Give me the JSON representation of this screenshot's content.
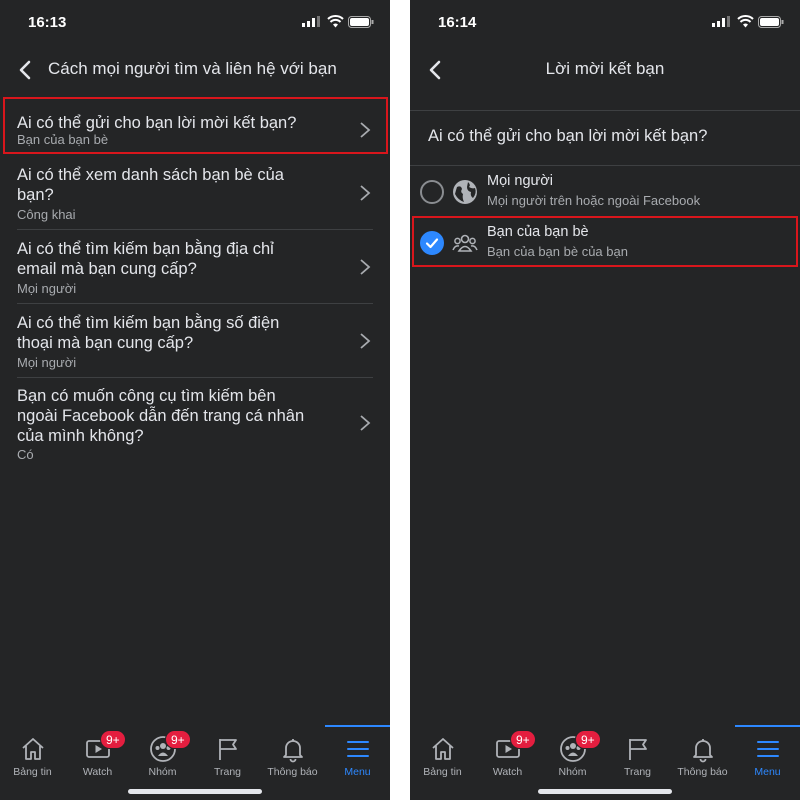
{
  "left": {
    "status_time": "16:13",
    "title": "Cách mọi người tìm và liên hệ với bạn",
    "rows": [
      {
        "question_lines": [
          "Ai có thể gửi cho bạn lời mời kết bạn?"
        ],
        "answer": "Bạn của bạn bè"
      },
      {
        "question_lines": [
          "Ai có thể xem danh sách bạn bè của",
          "bạn?"
        ],
        "answer": "Công khai"
      },
      {
        "question_lines": [
          "Ai có thể tìm kiếm bạn bằng địa chỉ",
          "email mà bạn cung cấp?"
        ],
        "answer": "Mọi người"
      },
      {
        "question_lines": [
          "Ai có thể tìm kiếm bạn bằng số điện",
          "thoại mà bạn cung cấp?"
        ],
        "answer": "Mọi người"
      },
      {
        "question_lines": [
          "Bạn có muốn công cụ tìm kiếm bên",
          "ngoài Facebook dẫn đến trang cá nhân",
          "của mình không?"
        ],
        "answer": "Có"
      }
    ]
  },
  "right": {
    "status_time": "16:14",
    "title": "Lời mời kết bạn",
    "question": "Ai có thể gửi cho bạn lời mời kết bạn?",
    "options": [
      {
        "title": "Mọi người",
        "subtitle": "Mọi người trên hoặc ngoài Facebook",
        "icon": "globe-icon",
        "selected": false
      },
      {
        "title": "Bạn của bạn bè",
        "subtitle": "Bạn của bạn bè của bạn",
        "icon": "friends-icon",
        "selected": true
      }
    ]
  },
  "tabbar": {
    "tabs": [
      {
        "label": "Bảng tin",
        "icon": "home-icon"
      },
      {
        "label": "Watch",
        "icon": "watch-icon",
        "badge": "9+"
      },
      {
        "label": "Nhóm",
        "icon": "groups-icon",
        "badge": "9+"
      },
      {
        "label": "Trang",
        "icon": "flag-icon"
      },
      {
        "label": "Thông báo",
        "icon": "bell-icon"
      },
      {
        "label": "Menu",
        "icon": "menu-icon",
        "active": true
      }
    ]
  },
  "colors": {
    "background": "#242526",
    "accent": "#2d88ff",
    "highlight": "#d9161c",
    "badge": "#e41e3f"
  }
}
